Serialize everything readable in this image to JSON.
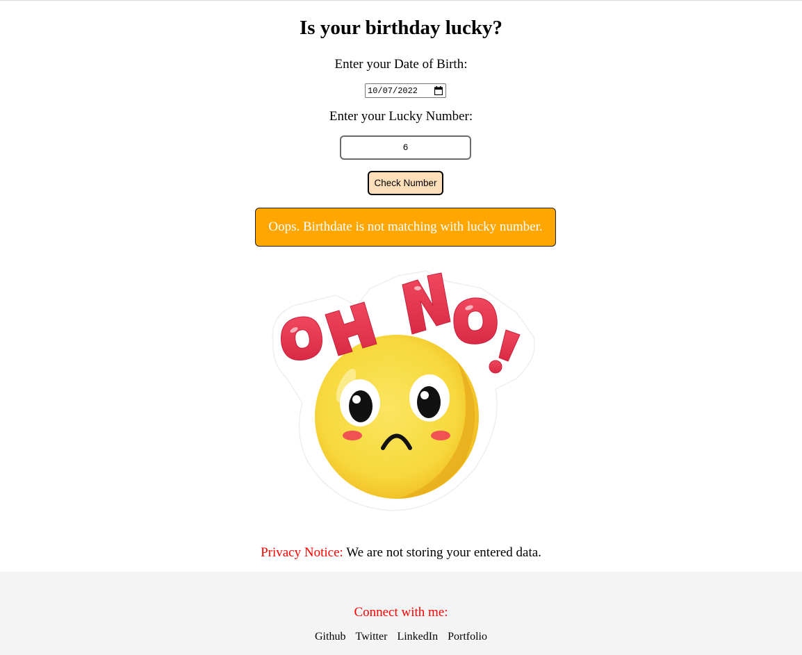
{
  "page": {
    "title": "Is your birthday lucky?"
  },
  "form": {
    "dob_label": "Enter your Date of Birth:",
    "dob_value": "10/07/2022",
    "lucky_label": "Enter your Lucky Number:",
    "lucky_value": "6",
    "check_button_label": "Check Number"
  },
  "result": {
    "message": "Oops. Birthdate is not matching with lucky number.",
    "background_color": "#ffa600",
    "sticker_text": "OH NO!"
  },
  "privacy": {
    "label": "Privacy Notice:",
    "text": " We are not storing your entered data."
  },
  "footer": {
    "heading": "Connect with me:",
    "links": [
      "Github",
      "Twitter",
      "LinkedIn",
      "Portfolio"
    ]
  },
  "colors": {
    "accent_red": "#ff0000",
    "button_bg": "#ffdfba",
    "footer_bg": "#f4f4f4"
  }
}
